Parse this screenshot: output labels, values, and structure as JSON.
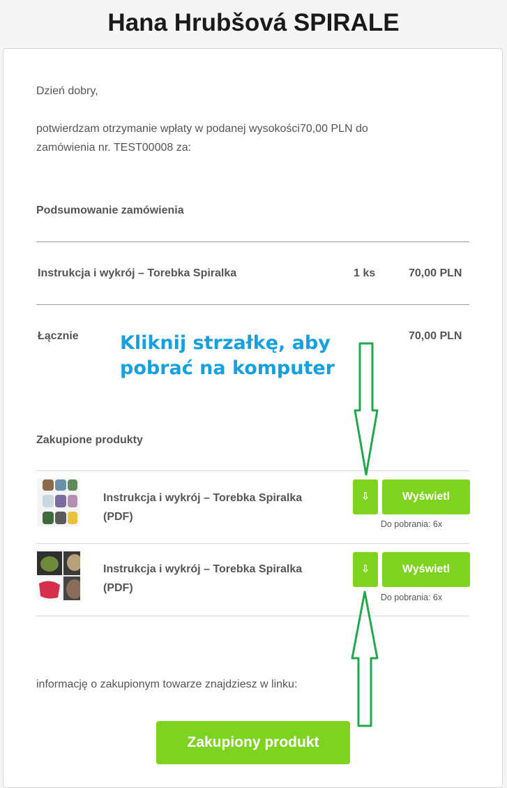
{
  "header": {
    "title": "Hana Hrubšová SPIRALE"
  },
  "greeting": "Dzień dobry,",
  "intro": {
    "line1": "potwierdzam otrzymanie wpłaty w podanej wysokości70,00 PLN do",
    "line2": "zamówienia nr. TEST00008 za:"
  },
  "summary": {
    "heading": "Podsumowanie zamówienia",
    "item": {
      "name": "Instrukcja i wykrój – Torebka Spiralka",
      "qty": "1 ks",
      "price": "70,00 PLN"
    },
    "total": {
      "label": "Łącznie",
      "value": "70,00 PLN"
    }
  },
  "annotation": {
    "line1": "Kliknij strzałkę, aby",
    "line2": "pobrać na komputer"
  },
  "purchased": {
    "heading": "Zakupione produkty",
    "products": [
      {
        "name_line1": "Instrukcja i wykrój – Torebka Spiralka",
        "name_line2": "(PDF)",
        "download_icon": "⇩",
        "view_label": "Wyświetl",
        "downloads_note": "Do pobrania: 6x"
      },
      {
        "name_line1": "Instrukcja i wykrój – Torebka Spiralka",
        "name_line2": "(PDF)",
        "download_icon": "⇩",
        "view_label": "Wyświetl",
        "downloads_note": "Do pobrania: 6x"
      }
    ]
  },
  "footer": {
    "info": "informację o zakupionym towarze znajdziesz w linku:",
    "button_label": "Zakupiony produkt"
  },
  "colors": {
    "accent": "#7ed321",
    "annotation": "#16a0de",
    "arrow": "#22a84a"
  }
}
